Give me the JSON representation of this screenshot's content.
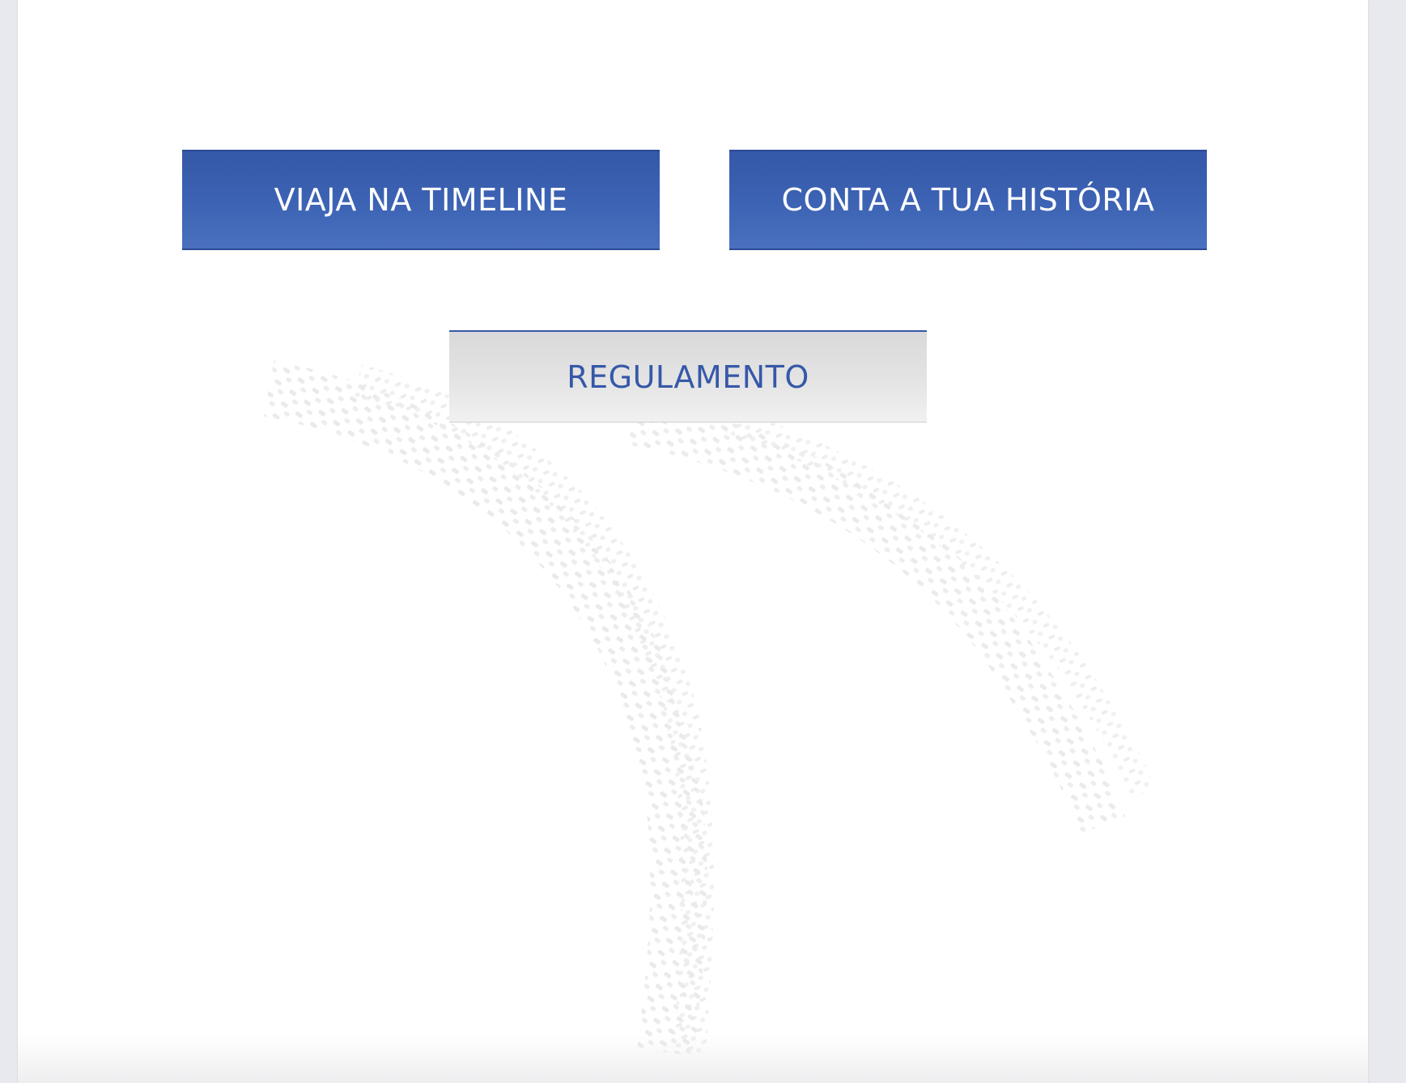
{
  "buttons": {
    "timeline_label": "VIAJA NA TIMELINE",
    "story_label": "CONTA A TUA HISTÓRIA",
    "rules_label": "REGULAMENTO"
  },
  "colors": {
    "primary_blue": "#3558a8",
    "secondary_gray": "#e4e4e4",
    "page_background": "#e8e9ee",
    "panel_background": "#ffffff"
  },
  "background": {
    "decoration": "tire-tracks"
  }
}
